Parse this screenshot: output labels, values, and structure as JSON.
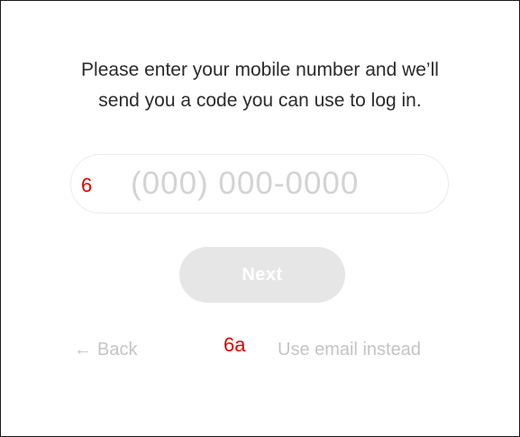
{
  "instructions": {
    "line1": "Please enter your mobile number and we’ll",
    "line2": "send you a code you can use to log in."
  },
  "phone": {
    "placeholder": "(000) 000-0000",
    "value": ""
  },
  "annotations": {
    "phone_field": "6",
    "email_link": "6a"
  },
  "actions": {
    "next_label": "Next",
    "back_arrow": "←",
    "back_label": "Back",
    "email_label": "Use email instead"
  },
  "colors": {
    "annotation": "#e00000",
    "disabled_button": "#e6e6e6",
    "link": "#c4c4c4"
  },
  "icons": {
    "back": "left-arrow-icon"
  }
}
